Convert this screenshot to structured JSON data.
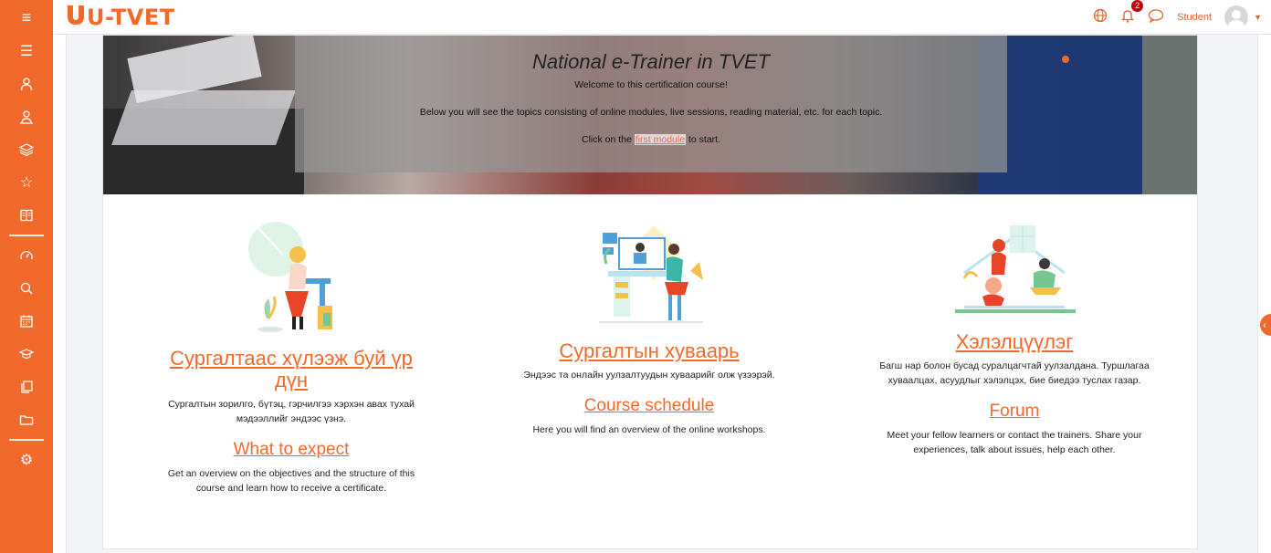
{
  "brand": {
    "name": "U-TVET",
    "accent": "#f16a2b"
  },
  "topbar": {
    "notifications_count": "2",
    "user_label": "Student"
  },
  "sidebar": {
    "icons": [
      "list-icon",
      "user-graduate-icon",
      "user-group-icon",
      "layers-icon",
      "star-icon",
      "book-icon",
      "dashboard-icon",
      "search-icon",
      "calendar-icon",
      "graduation-cap-icon",
      "book-copy-icon",
      "folder-icon",
      "settings-icon"
    ]
  },
  "hero": {
    "title": "National e-Trainer in TVET",
    "welcome": "Welcome to this certification course!",
    "description": "Below you will see the topics consisting of online modules, live sessions, reading material, etc. for each topic.",
    "click_prefix": "Click on the",
    "click_link": "first module",
    "click_suffix": "to start."
  },
  "columns": [
    {
      "title_mn": "Сургалтаас хүлээж буй үр дүн",
      "desc_mn": "Сургалтын зорилго, бүтэц, гэрчилгээ хэрхэн авах тухай мэдээллийг эндээс үзнэ.",
      "title_en": "What to expect",
      "desc_en": "Get an overview on the objectives and the structure of this course and learn how to receive a certificate."
    },
    {
      "title_mn": "Сургалтын хуваарь",
      "desc_mn": "Эндээс та онлайн уулзалтуудын хуваарийг олж үзээрэй.",
      "title_en": "Course schedule",
      "desc_en": "Here you will find an overview of the online workshops."
    },
    {
      "title_mn": "Хэлэлцүүлэг",
      "desc_mn": "Багш нар болон бусад суралцагчтай уулзалдана. Туршлагаа хуваалцах, асуудлыг хэлэлцэх, бие биедээ туслах газар.",
      "title_en": "Forum",
      "desc_en": "Meet your fellow learners or contact the trainers. Share your experiences, talk about issues, help each other."
    }
  ]
}
